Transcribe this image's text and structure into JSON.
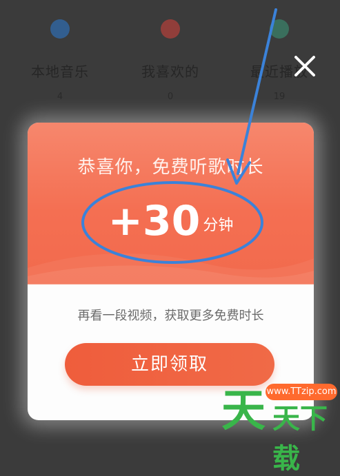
{
  "background_tabs": [
    {
      "label": "本地音乐",
      "count": "4",
      "icon": "music-icon",
      "color": "#2b7bd6"
    },
    {
      "label": "我喜欢的",
      "count": "0",
      "icon": "heart-icon",
      "color": "#d9423a"
    },
    {
      "label": "最近播放",
      "count": "19",
      "icon": "recent-icon",
      "color": "#3a9a7a"
    }
  ],
  "dialog": {
    "close_icon": "close-icon",
    "congrats_text": "恭喜你，免费听歌时长",
    "reward_amount": "+30",
    "reward_unit": "分钟",
    "hint_text": "再看一段视频，获取更多免费时长",
    "claim_button": "立即领取"
  },
  "watermark": {
    "logo_text": "天天下载",
    "url_text": "www.TTzip.com",
    "big_char": "天",
    "rest_chars": "天下载"
  },
  "colors": {
    "accent": "#f26a4d",
    "button": "#ef5d3c",
    "annotation_blue": "#3b82d9"
  }
}
